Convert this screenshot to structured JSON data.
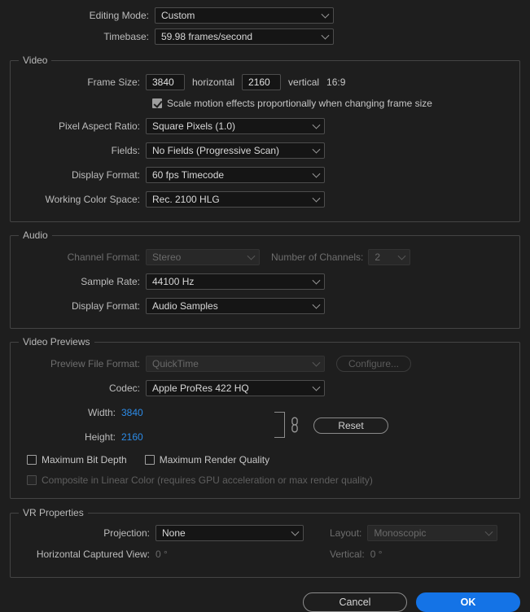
{
  "top": {
    "editing_mode_label": "Editing Mode:",
    "editing_mode_value": "Custom",
    "timebase_label": "Timebase:",
    "timebase_value": "59.98  frames/second"
  },
  "video": {
    "title": "Video",
    "frame_size_label": "Frame Size:",
    "frame_width": "3840",
    "horizontal_label": "horizontal",
    "frame_height": "2160",
    "vertical_label": "vertical",
    "aspect_ratio": "16:9",
    "scale_motion_label": "Scale motion effects proportionally when changing frame size",
    "pixel_aspect_label": "Pixel Aspect Ratio:",
    "pixel_aspect_value": "Square Pixels (1.0)",
    "fields_label": "Fields:",
    "fields_value": "No Fields (Progressive Scan)",
    "display_format_label": "Display Format:",
    "display_format_value": "60 fps Timecode",
    "color_space_label": "Working Color Space:",
    "color_space_value": "Rec. 2100 HLG"
  },
  "audio": {
    "title": "Audio",
    "channel_format_label": "Channel Format:",
    "channel_format_value": "Stereo",
    "num_channels_label": "Number of Channels:",
    "num_channels_value": "2",
    "sample_rate_label": "Sample Rate:",
    "sample_rate_value": "44100 Hz",
    "display_format_label": "Display Format:",
    "display_format_value": "Audio Samples"
  },
  "previews": {
    "title": "Video Previews",
    "file_format_label": "Preview File Format:",
    "file_format_value": "QuickTime",
    "configure_label": "Configure...",
    "codec_label": "Codec:",
    "codec_value": "Apple ProRes 422 HQ",
    "width_label": "Width:",
    "width_value": "3840",
    "height_label": "Height:",
    "height_value": "2160",
    "reset_label": "Reset",
    "max_bit_depth_label": "Maximum Bit Depth",
    "max_render_quality_label": "Maximum Render Quality",
    "composite_linear_label": "Composite in Linear Color (requires GPU acceleration or max render quality)"
  },
  "vr": {
    "title": "VR Properties",
    "projection_label": "Projection:",
    "projection_value": "None",
    "layout_label": "Layout:",
    "layout_value": "Monoscopic",
    "horizontal_view_label": "Horizontal Captured View:",
    "horizontal_view_value": "0 °",
    "vertical_label": "Vertical:",
    "vertical_value": "0 °"
  },
  "footer": {
    "cancel_label": "Cancel",
    "ok_label": "OK"
  },
  "colors": {
    "accent": "#1473e6",
    "value_blue": "#2d8ce8",
    "background": "#1e1e1e"
  }
}
